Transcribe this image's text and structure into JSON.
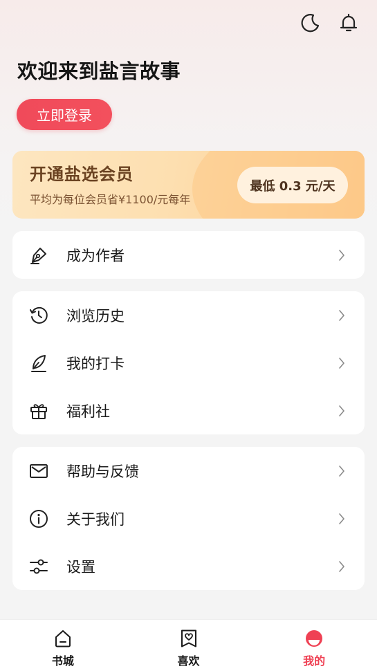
{
  "header": {
    "welcome": "欢迎来到盐言故事",
    "login_label": "立即登录"
  },
  "vip": {
    "title": "开通盐选会员",
    "subtitle": "平均为每位会员省¥1100/元每年",
    "price": "最低 0.3 元/天"
  },
  "groups": [
    {
      "items": [
        {
          "label": "成为作者",
          "icon": "pen-nib-icon"
        }
      ]
    },
    {
      "items": [
        {
          "label": "浏览历史",
          "icon": "history-icon"
        },
        {
          "label": "我的打卡",
          "icon": "feather-icon"
        },
        {
          "label": "福利社",
          "icon": "gift-icon"
        }
      ]
    },
    {
      "items": [
        {
          "label": "帮助与反馈",
          "icon": "mail-icon"
        },
        {
          "label": "关于我们",
          "icon": "info-icon"
        },
        {
          "label": "设置",
          "icon": "sliders-icon"
        }
      ]
    }
  ],
  "tabs": [
    {
      "label": "书城",
      "icon": "home-icon",
      "active": false
    },
    {
      "label": "喜欢",
      "icon": "heart-bookmark-icon",
      "active": false
    },
    {
      "label": "我的",
      "icon": "profile-icon",
      "active": true
    }
  ],
  "colors": {
    "accent": "#ef4154",
    "vip_text": "#6b4322"
  }
}
